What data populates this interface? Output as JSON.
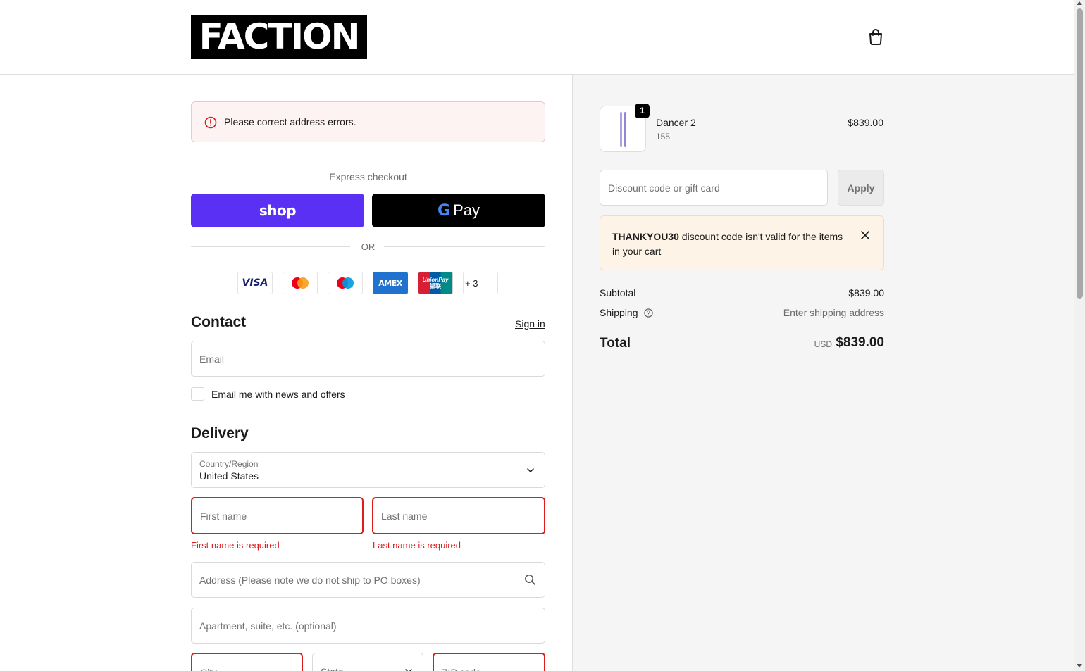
{
  "header": {
    "logo_text": "FACTION",
    "cart_icon": "shopping-bag-icon"
  },
  "alert": {
    "icon": "error-circle-icon",
    "message": "Please correct address errors."
  },
  "express": {
    "label": "Express checkout",
    "shop_label": "shop",
    "gpay_g": "G",
    "gpay_label": "Pay",
    "or_label": "OR"
  },
  "payment_cards": {
    "visa": "VISA",
    "amex": "AMEX",
    "unionpay": "UnionPay",
    "unionpay_cn": "银联",
    "more": "+ 3"
  },
  "contact": {
    "title": "Contact",
    "sign_in": "Sign in",
    "email_placeholder": "Email",
    "newsletter_label": "Email me with news and offers"
  },
  "delivery": {
    "title": "Delivery",
    "country_label": "Country/Region",
    "country_value": "United States",
    "first_name_placeholder": "First name",
    "last_name_placeholder": "Last name",
    "first_name_error": "First name is required",
    "last_name_error": "Last name is required",
    "address_placeholder": "Address (Please note we do not ship to PO boxes)",
    "apartment_placeholder": "Apartment, suite, etc. (optional)",
    "city_placeholder": "City",
    "state_placeholder": "State",
    "zip_placeholder": "ZIP code"
  },
  "cart": {
    "item": {
      "quantity": "1",
      "name": "Dancer 2",
      "variant": "155",
      "price": "$839.00"
    },
    "discount_placeholder": "Discount code or gift card",
    "apply_label": "Apply",
    "warning": {
      "code": "THANKYOU30",
      "message": " discount code isn't valid for the items in your cart"
    },
    "subtotal_label": "Subtotal",
    "subtotal_value": "$839.00",
    "shipping_label": "Shipping",
    "shipping_value": "Enter shipping address",
    "total_label": "Total",
    "total_currency": "USD",
    "total_value": "$839.00"
  },
  "colors": {
    "shop_purple": "#5a31f4",
    "error_red": "#dd1d1d",
    "alert_bg": "#fdf3f3",
    "warning_bg": "#fdf3e7"
  }
}
